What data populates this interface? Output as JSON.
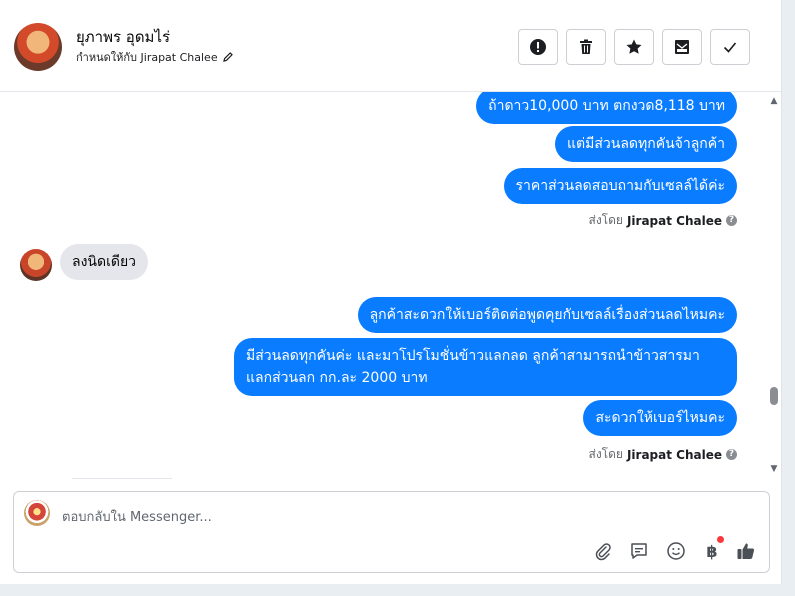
{
  "header": {
    "contact_name": "ยุภาพร อุดมไร่",
    "assigned_to": "กำหนดให้กับ Jirapat Chalee",
    "actions": [
      "spam-icon",
      "trash-icon",
      "star-icon",
      "archive-icon",
      "check-icon"
    ]
  },
  "thread": {
    "outgoing_group_1": [
      "ถ้าดาว10,000 บาท ตกงวด8,118 บาท",
      "แต่มีส่วนลดทุกคันจ้าลูกค้า",
      "ราคาส่วนลดสอบถามกับเซลล์ได้ค่ะ"
    ],
    "sent_by_1": {
      "prefix": "ส่งโดย",
      "name": "Jirapat Chalee"
    },
    "incoming_1": "ลงนิดเดียว",
    "outgoing_group_2": [
      "ลูกค้าสะดวกให้เบอร์ติดต่อพูดคุยกับเซลล์เรื่องส่วนลดไหมคะ",
      "มีส่วนลดทุกคันค่ะ และมาโปรโมชั่นข้าวแลกลด ลูกค้าสามารถนำข้าวสารมา",
      "แลกส่วนลก กก.ละ 2000 บาท",
      "สะดวกให้เบอร์ไหมคะ"
    ],
    "sent_by_2": {
      "prefix": "ส่งโดย",
      "name": "Jirapat Chalee"
    },
    "info_glyph": "?"
  },
  "composer": {
    "placeholder": "ตอบกลับใน Messenger...",
    "tools": [
      "attach-icon",
      "saved-reply-icon",
      "emoji-icon",
      "payment-icon",
      "like-icon"
    ],
    "currency_glyph": "฿"
  },
  "colors": {
    "outgoing_bubble": "#0a7cff",
    "incoming_bubble": "#e4e6eb",
    "notification_dot": "#fa383e"
  }
}
